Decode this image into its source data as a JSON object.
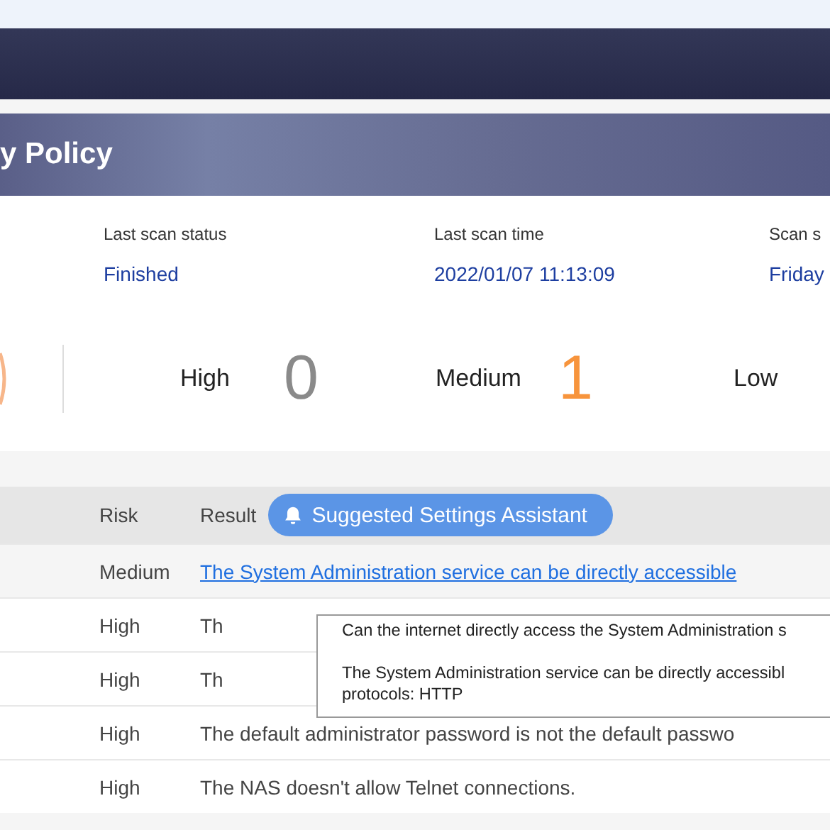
{
  "banner": {
    "title": "y Policy"
  },
  "scan_info": [
    {
      "label": "Last scan status",
      "value": "Finished"
    },
    {
      "label": "Last scan time",
      "value": "2022/01/07 11:13:09"
    },
    {
      "label": "Scan s",
      "value": "Friday"
    }
  ],
  "risk_counts": [
    {
      "label": "High",
      "count": "0",
      "color": "#8a8a8a"
    },
    {
      "label": "Medium",
      "count": "1",
      "color": "#f7943c"
    },
    {
      "label": "Low"
    }
  ],
  "table": {
    "columns": [
      "Risk",
      "Result"
    ],
    "assistant_button": "Suggested Settings Assistant",
    "rows": [
      {
        "risk": "Medium",
        "result": "The System Administration service can be directly accessible",
        "selected": true
      },
      {
        "risk": "High",
        "result": "Th",
        "selected": false
      },
      {
        "risk": "High",
        "result": "Th",
        "selected": false
      },
      {
        "risk": "High",
        "result": "The default administrator password is not the default passwo",
        "selected": false
      },
      {
        "risk": "High",
        "result": "The NAS doesn't allow Telnet connections.",
        "selected": false
      }
    ]
  },
  "tooltip": {
    "question": "Can the internet directly access the System Administration s",
    "answer": "The System Administration service can be directly accessibl",
    "answer_line2": "protocols: HTTP"
  }
}
